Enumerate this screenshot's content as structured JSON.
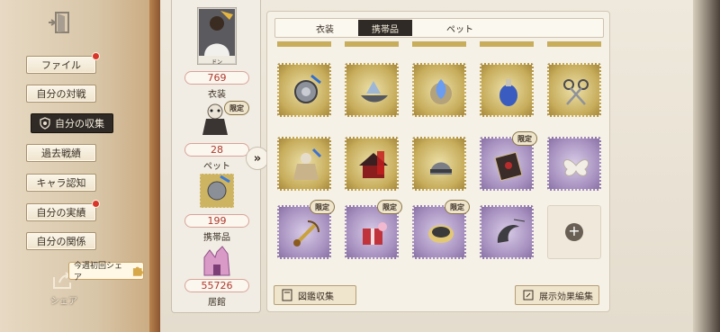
{
  "menu": {
    "items": [
      {
        "label": "ファイル",
        "badge": true
      },
      {
        "label": "自分の対戦",
        "badge": false
      },
      {
        "label": "自分の収集",
        "badge": false,
        "active": true
      },
      {
        "label": "過去戦績",
        "badge": false
      },
      {
        "label": "キャラ認知",
        "badge": false
      },
      {
        "label": "自分の実績",
        "badge": true
      },
      {
        "label": "自分の関係",
        "badge": false
      }
    ],
    "share_label": "シェア",
    "share_bubble": "今週初回シェア"
  },
  "stats": {
    "portrait_name": "ドン",
    "costume": {
      "value": "769",
      "label": "衣装"
    },
    "pet": {
      "value": "28",
      "label": "ペット"
    },
    "accessory": {
      "value": "199",
      "label": "携帯品"
    },
    "residence": {
      "value": "55726",
      "label": "居館"
    },
    "pet_limited": "限定"
  },
  "tabs": [
    {
      "label": "衣装"
    },
    {
      "label": "携帯品",
      "active": true
    },
    {
      "label": "ペット"
    }
  ],
  "grid": {
    "rows": [
      [
        {
          "icon": "gear-trinket-icon",
          "bg": "gold"
        },
        {
          "icon": "ship-trinket-icon",
          "bg": "gold"
        },
        {
          "icon": "blue-flame-trinket-icon",
          "bg": "gold"
        },
        {
          "icon": "potion-trinket-icon",
          "bg": "gold"
        },
        {
          "icon": "scissors-trinket-icon",
          "bg": "gold"
        }
      ],
      [
        {
          "icon": "doll-trinket-icon",
          "bg": "gold"
        },
        {
          "icon": "red-house-trinket-icon",
          "bg": "gold"
        },
        {
          "icon": "helmet-trinket-icon",
          "bg": "gold"
        },
        {
          "icon": "card-trinket-icon",
          "bg": "purple",
          "limited": "限定"
        },
        {
          "icon": "moth-trinket-icon",
          "bg": "purple"
        }
      ],
      [
        {
          "icon": "sword-trinket-icon",
          "bg": "purple",
          "limited": "限定"
        },
        {
          "icon": "gift-box-trinket-icon",
          "bg": "purple",
          "limited": "限定"
        },
        {
          "icon": "drum-trinket-icon",
          "bg": "purple",
          "limited": "限定"
        },
        {
          "icon": "claw-trinket-icon",
          "bg": "purple"
        },
        {
          "icon": "plus-icon",
          "bg": "empty"
        }
      ]
    ]
  },
  "buttons": {
    "catalog": "図鑑収集",
    "display": "展示効果編集"
  },
  "colors": {
    "active_bg": "#2f2a26",
    "badge_red": "#d8362b",
    "stat_value_red": "#b03a2e",
    "stamp_gold": "#c7ad5c",
    "stamp_purple": "#a690bf"
  }
}
